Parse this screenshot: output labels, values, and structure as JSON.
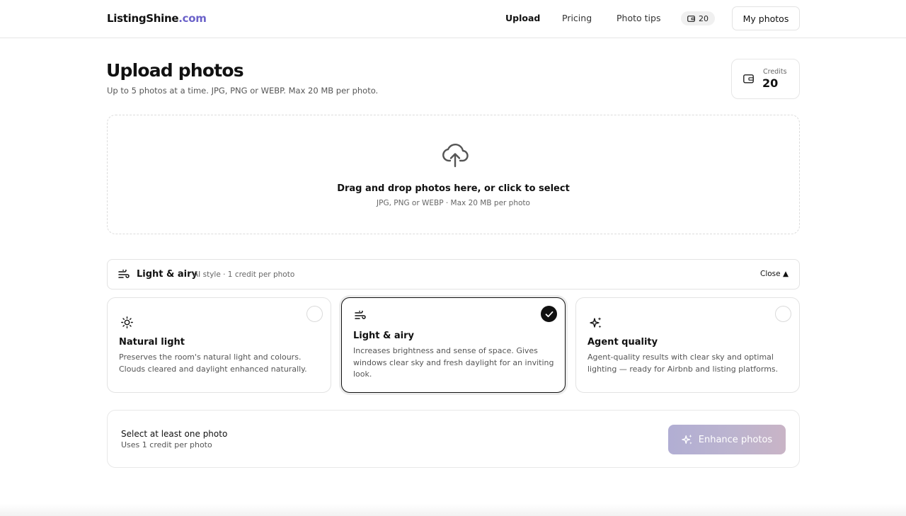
{
  "header": {
    "logo_main": "ListingShine",
    "logo_tld": ".com",
    "nav": [
      {
        "label": "Upload",
        "active": true
      },
      {
        "label": "Pricing",
        "active": false
      },
      {
        "label": "Photo tips",
        "active": false
      }
    ],
    "credit_badge": "20",
    "credit_icon": "wallet-icon",
    "my_photos_label": "My photos"
  },
  "page": {
    "title": "Upload photos",
    "subtitle": "Up to 5 photos at a time. JPG, PNG or WEBP. Max 20 MB per photo."
  },
  "credits": {
    "label": "Credits",
    "value": "20"
  },
  "dropzone": {
    "icon": "cloud-upload-icon",
    "title": "Drag and drop photos here, or click to select",
    "subtitle": "JPG, PNG or WEBP · Max 20 MB per photo"
  },
  "style_selector": {
    "icon": "wind-icon",
    "current": "Light & airy",
    "meta": "AI style · 1 credit per photo",
    "close_label": "Close ▲",
    "options": [
      {
        "icon": "sun-icon",
        "title": "Natural light",
        "description": "Preserves the room's natural light and colours. Clouds cleared and daylight enhanced naturally.",
        "selected": false
      },
      {
        "icon": "wind-icon",
        "title": "Light & airy",
        "description": "Increases brightness and sense of space. Gives windows clear sky and fresh daylight for an inviting look.",
        "selected": true
      },
      {
        "icon": "sparkles-icon",
        "title": "Agent quality",
        "description": "Agent-quality results with clear sky and optimal lighting — ready for Airbnb and listing platforms.",
        "selected": false
      }
    ]
  },
  "action": {
    "title": "Select at least one photo",
    "subtitle": "Uses 1 credit per photo",
    "button_label": "Enhance photos",
    "button_icon": "sparkles-icon",
    "button_disabled": true
  },
  "colors": {
    "accent": "#6b62c9",
    "text": "#111111",
    "muted": "#555555",
    "border": "#e3e3e3"
  }
}
